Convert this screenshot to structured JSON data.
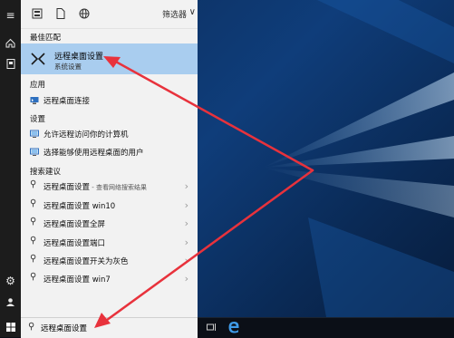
{
  "rail": {
    "icons": [
      "menu-icon",
      "home-icon",
      "documents-icon",
      "settings-icon",
      "user-icon"
    ]
  },
  "header": {
    "filter_label": "筛选器"
  },
  "sections": {
    "best_match": "最佳匹配",
    "apps": "应用",
    "settings": "设置",
    "suggestions": "搜索建议"
  },
  "best_match": {
    "title": "远程桌面设置",
    "subtitle": "系统设置"
  },
  "apps": [
    {
      "label": "远程桌面连接"
    }
  ],
  "settings": [
    {
      "label": "允许远程访问你的计算机"
    },
    {
      "label": "选择能够使用远程桌面的用户"
    }
  ],
  "suggestions": [
    {
      "label": "远程桌面设置",
      "sub": " - 查看网络搜索结果"
    },
    {
      "label": "远程桌面设置 win10",
      "sub": ""
    },
    {
      "label": "远程桌面设置全屏",
      "sub": ""
    },
    {
      "label": "远程桌面设置端口",
      "sub": ""
    },
    {
      "label": "远程桌面设置开关为灰色",
      "sub": ""
    },
    {
      "label": "远程桌面设置 win7",
      "sub": ""
    }
  ],
  "search": {
    "value": "远程桌面设置"
  },
  "colors": {
    "highlight": "#a9cdef",
    "arrow": "#e8323c",
    "desktop": "#0f3d7a"
  }
}
